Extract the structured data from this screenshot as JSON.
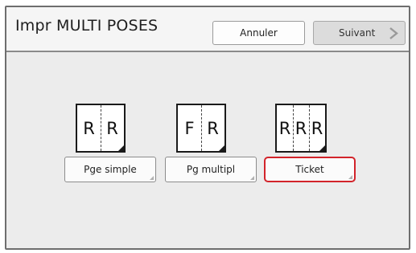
{
  "header": {
    "title": "Impr MULTI POSES",
    "cancel_label": "Annuler",
    "next_label": "Suivant"
  },
  "options": [
    {
      "label": "Pge simple",
      "preview": [
        "R",
        "R"
      ],
      "selected": false
    },
    {
      "label": "Pg multipl",
      "preview": [
        "F",
        "R"
      ],
      "selected": false
    },
    {
      "label": "Ticket",
      "preview": [
        "R",
        "R",
        "R"
      ],
      "selected": true
    }
  ],
  "colors": {
    "selection": "#d2232a",
    "disabled_button": "#dcdcdc"
  },
  "icons": {
    "next": "chevron-right-icon"
  }
}
